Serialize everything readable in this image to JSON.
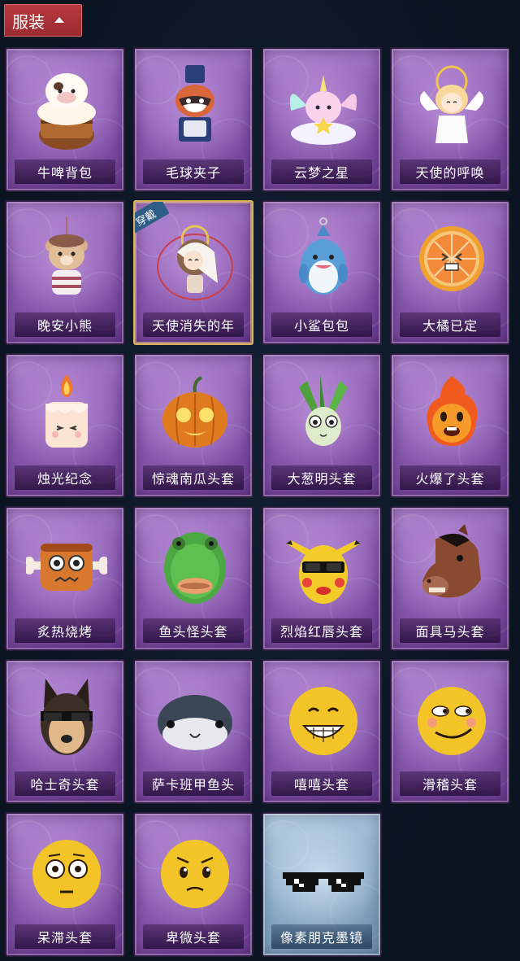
{
  "header": {
    "tab_label": "服装"
  },
  "wear_badge": "穿戴",
  "items": [
    {
      "label": "牛啤背包",
      "icon": "cow-beer-barrel-icon"
    },
    {
      "label": "毛球夹子",
      "icon": "raccoon-soldier-icon"
    },
    {
      "label": "云梦之星",
      "icon": "unicorn-cloud-icon"
    },
    {
      "label": "天使的呼唤",
      "icon": "angel-doll-icon"
    },
    {
      "label": "晚安小熊",
      "icon": "teddy-bear-icon"
    },
    {
      "label": "天使消失的年",
      "icon": "veiled-angel-doll-icon"
    },
    {
      "label": "小鲨包包",
      "icon": "shark-plush-icon"
    },
    {
      "label": "大橘已定",
      "icon": "orange-slice-icon"
    },
    {
      "label": "烛光纪念",
      "icon": "candle-face-icon"
    },
    {
      "label": "惊魂南瓜头套",
      "icon": "pumpkin-head-icon"
    },
    {
      "label": "大葱明头套",
      "icon": "green-onion-head-icon"
    },
    {
      "label": "火爆了头套",
      "icon": "fire-face-head-icon"
    },
    {
      "label": "炙热烧烤",
      "icon": "bbq-meat-icon"
    },
    {
      "label": "鱼头怪头套",
      "icon": "fish-monster-head-icon"
    },
    {
      "label": "烈焰红唇头套",
      "icon": "pikachu-sunglasses-head-icon"
    },
    {
      "label": "面具马头套",
      "icon": "horse-mask-head-icon"
    },
    {
      "label": "哈士奇头套",
      "icon": "husky-sunglasses-head-icon"
    },
    {
      "label": "萨卡班甲鱼头",
      "icon": "sacabambaspis-head-icon"
    },
    {
      "label": "嘻嘻头套",
      "icon": "grin-emoji-head-icon"
    },
    {
      "label": "滑稽头套",
      "icon": "smirk-emoji-head-icon"
    },
    {
      "label": "呆滞头套",
      "icon": "stunned-emoji-head-icon"
    },
    {
      "label": "卑微头套",
      "icon": "timid-emoji-head-icon"
    },
    {
      "label": "像素朋克墨镜",
      "icon": "pixel-sunglasses-icon"
    }
  ],
  "selected_index": 5,
  "colors": {
    "background": "#0b1421",
    "card_purple": "#8e5fb5",
    "card_blue": "#8fb0cb",
    "tab_red": "#b83a3f",
    "selected_border": "#d9b25a"
  }
}
